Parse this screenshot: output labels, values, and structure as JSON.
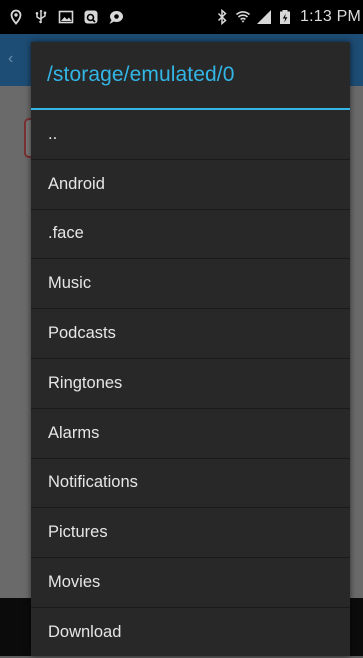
{
  "status_bar": {
    "time": "1:13 PM",
    "left_icons": [
      "location-icon",
      "usb-icon",
      "gallery-icon",
      "ok-google-icon",
      "chat-icon"
    ],
    "right_icons": [
      "bluetooth-icon",
      "wifi-icon",
      "signal-icon",
      "battery-icon"
    ]
  },
  "dialog": {
    "title": "/storage/emulated/0",
    "accent_color": "#33b5e5",
    "items": [
      {
        "label": ".."
      },
      {
        "label": "Android"
      },
      {
        "label": ".face"
      },
      {
        "label": "Music"
      },
      {
        "label": "Podcasts"
      },
      {
        "label": "Ringtones"
      },
      {
        "label": "Alarms"
      },
      {
        "label": "Notifications"
      },
      {
        "label": "Pictures"
      },
      {
        "label": "Movies"
      },
      {
        "label": "Download"
      }
    ]
  }
}
